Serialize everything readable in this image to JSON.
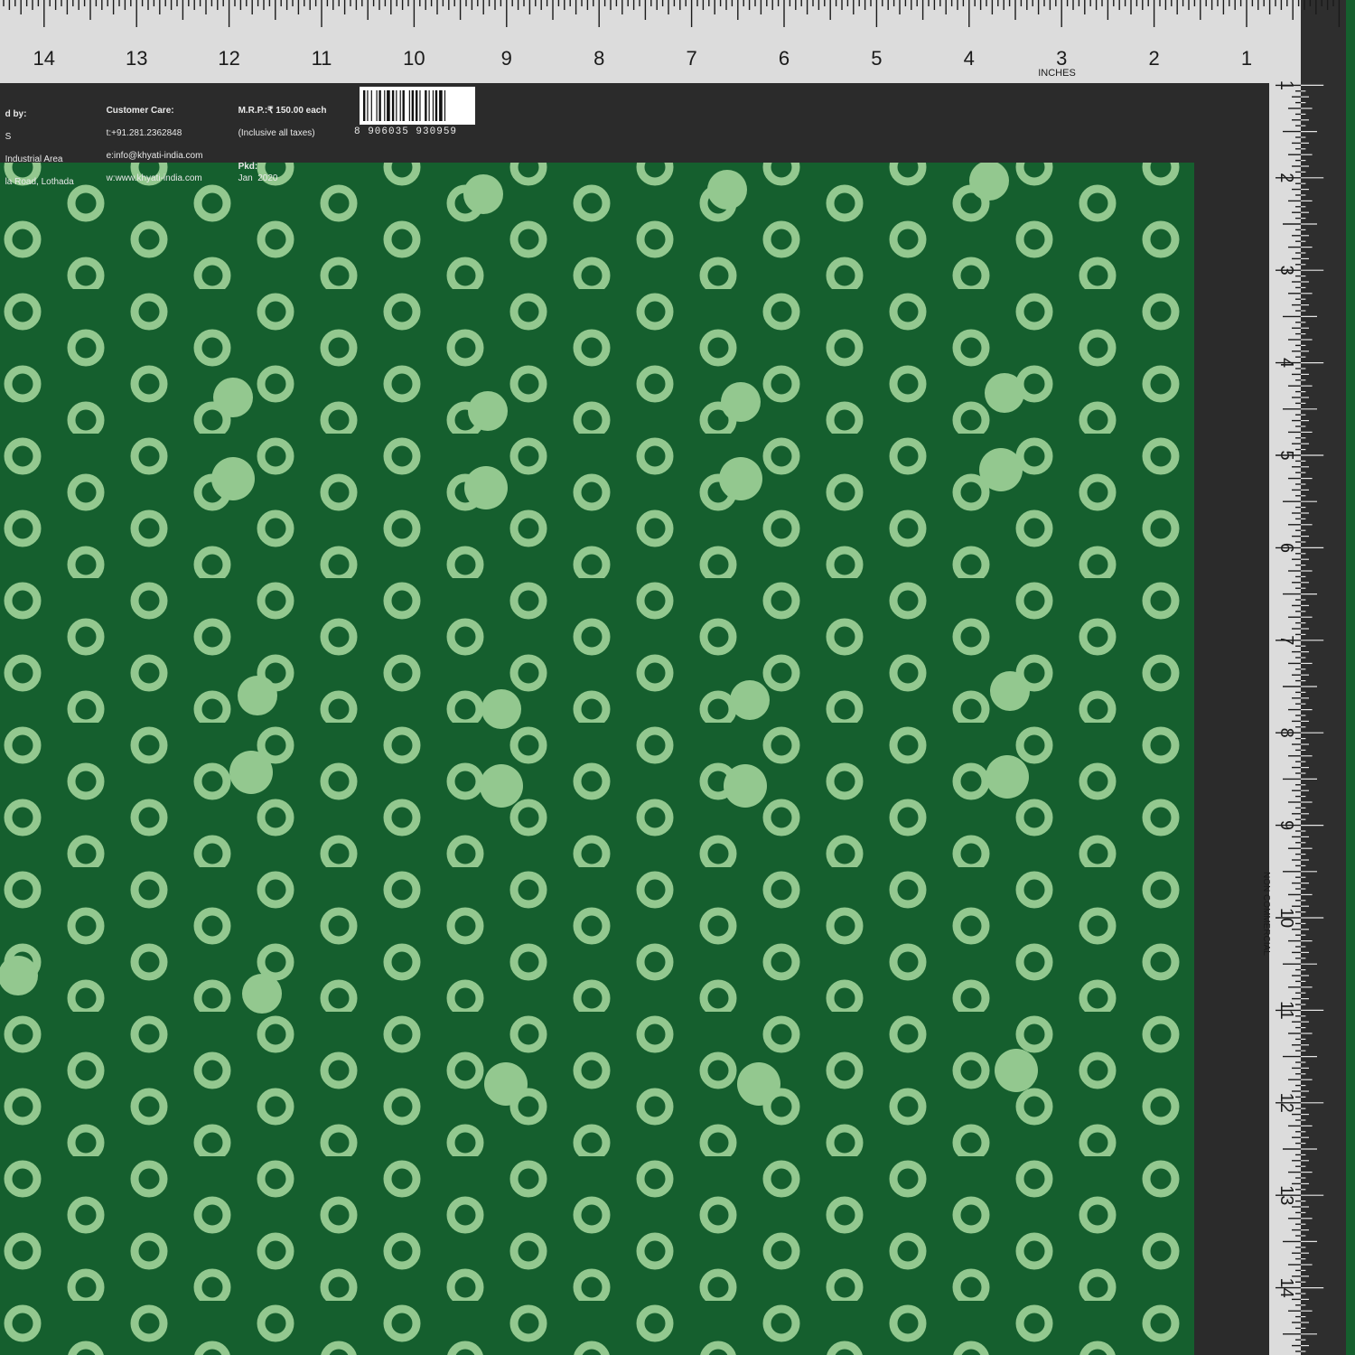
{
  "colors": {
    "fabric_green": "#155f2e",
    "print_ring": "#93c88f",
    "ruler_face": "#dcdcdc",
    "ruler_dark_band": "#2b2b2b"
  },
  "ruler": {
    "top_numbers": [
      "14",
      "13",
      "12",
      "11",
      "10",
      "9",
      "8",
      "7",
      "6",
      "5",
      "4",
      "3",
      "2",
      "1"
    ],
    "side_numbers": [
      "1",
      "2",
      "3",
      "4",
      "5",
      "6",
      "7",
      "8",
      "9",
      "10",
      "11",
      "12",
      "13",
      "14"
    ],
    "unit_label": "INCHES",
    "side_note": "NON COMMERCIAL"
  },
  "label": {
    "manufacturer": {
      "heading": "d by:",
      "line1": "S",
      "line2": "Industrial Area",
      "line3": "la Road, Lothada"
    },
    "customer_care": {
      "heading": "Customer Care:",
      "phone": "t:+91.281.2362848",
      "email": "e:info@khyati-india.com",
      "web": "w:www.khyati-india.com"
    },
    "price": {
      "heading": "M.R.P.:₹ 150.00 each",
      "note": "(Inclusive all taxes)",
      "packed_label": "Pkd:",
      "packed_date": "Jan  2020"
    },
    "barcode_number": "8 906035 930959"
  }
}
